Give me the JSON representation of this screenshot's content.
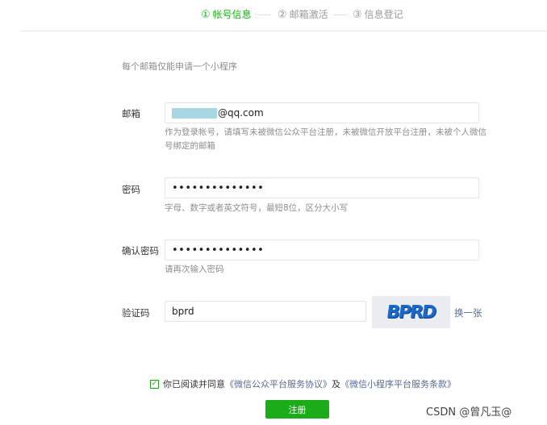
{
  "steps": [
    {
      "num": "①",
      "label": "帐号信息",
      "active": true
    },
    {
      "num": "②",
      "label": "邮箱激活",
      "active": false
    },
    {
      "num": "③",
      "label": "信息登记",
      "active": false
    }
  ],
  "form": {
    "top_hint": "每个邮箱仅能申请一个小程序",
    "email": {
      "label": "邮箱",
      "value_suffix": "@qq.com",
      "help": "作为登录帐号，请填写未被微信公众平台注册，未被微信开放平台注册，未被个人微信号绑定的邮箱"
    },
    "password": {
      "label": "密码",
      "value": "••••••••••••••",
      "help": "字母、数字或者英文符号，最短8位，区分大小写"
    },
    "confirm_password": {
      "label": "确认密码",
      "value": "••••••••••••••",
      "help": "请再次输入密码"
    },
    "captcha": {
      "label": "验证码",
      "value": "bprd",
      "image_text": "BPRD",
      "refresh_label": "换一张"
    }
  },
  "agreement": {
    "prefix": "你已阅读并同意",
    "link1": "《微信公众平台服务协议》",
    "and": "及",
    "link2": "《微信小程序平台服务条款》",
    "checked": true
  },
  "submit_label": "注册",
  "watermark": "CSDN @曾凡玉@",
  "colors": {
    "accent": "#1aad19",
    "link": "#576b95"
  }
}
